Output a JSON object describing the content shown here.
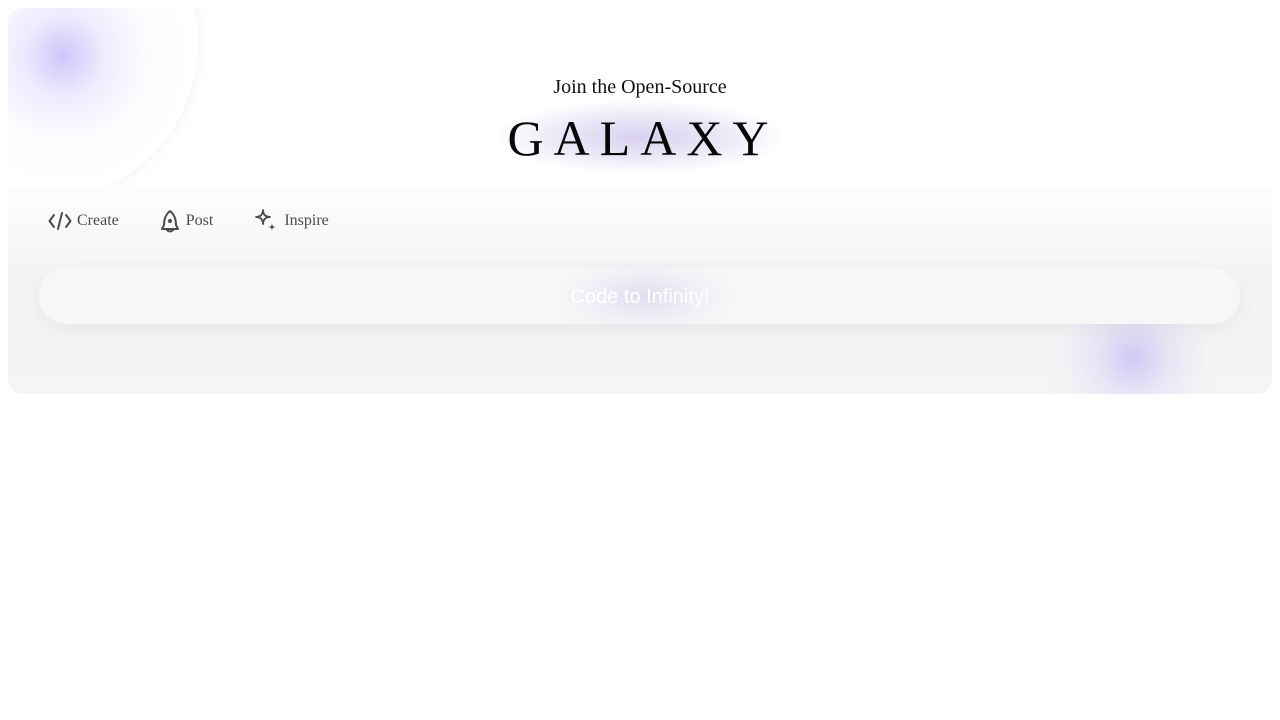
{
  "hero": {
    "subtitle": "Join the Open-Source",
    "title": "GALAXY"
  },
  "nav": {
    "items": [
      {
        "label": "Create",
        "icon": "code-icon"
      },
      {
        "label": "Post",
        "icon": "rocket-icon"
      },
      {
        "label": "Inspire",
        "icon": "sparkles-icon"
      }
    ]
  },
  "cta": {
    "text": "Code to Infinity!"
  },
  "colors": {
    "glow": "#b4a5f5",
    "text_muted": "#4b4b4b",
    "bar": "#f7f7f7"
  }
}
